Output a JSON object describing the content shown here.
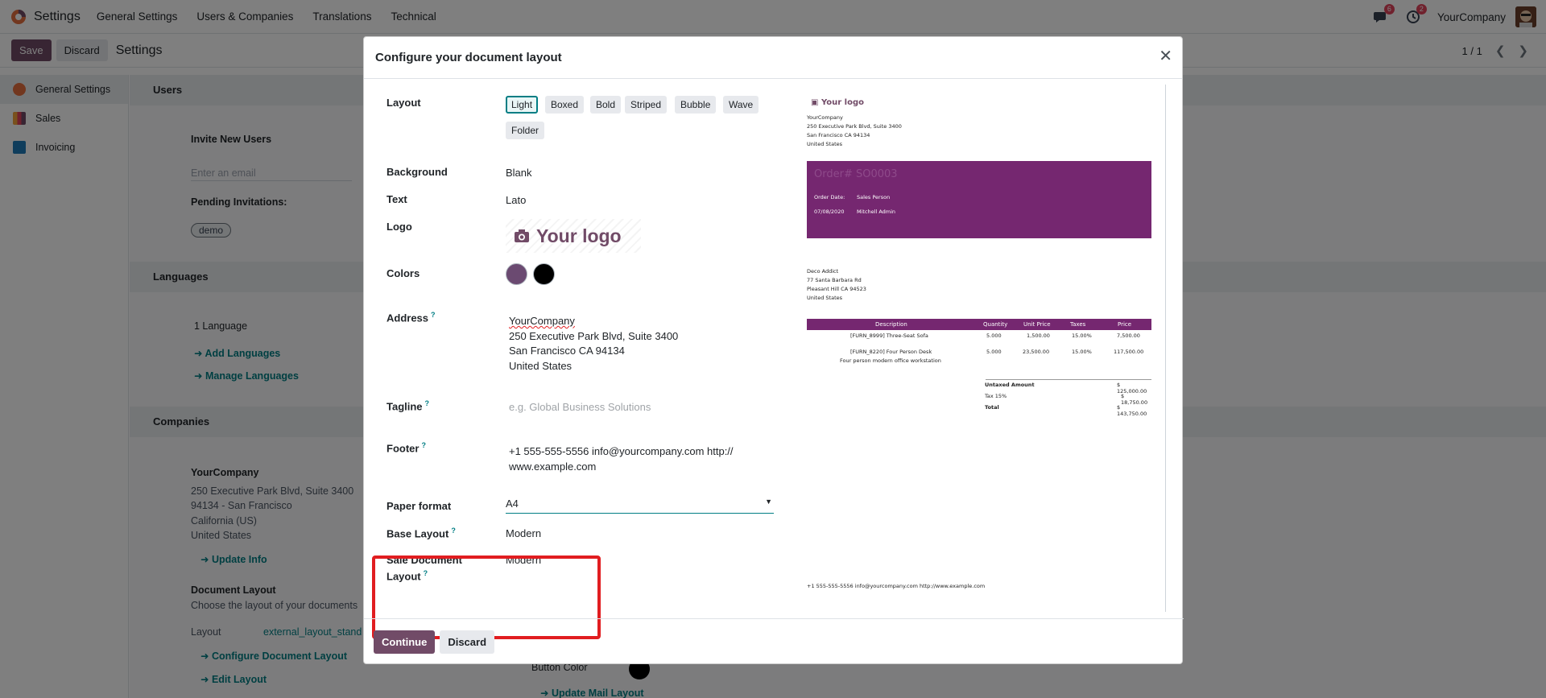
{
  "navbar": {
    "app_name": "Settings",
    "menus": [
      "General Settings",
      "Users & Companies",
      "Translations",
      "Technical"
    ],
    "messages_badge": "6",
    "activities_badge": "2",
    "company": "YourCompany"
  },
  "control": {
    "save_label": "Save",
    "discard_label": "Discard",
    "title": "Settings",
    "pager": "1 / 1"
  },
  "sidebar": {
    "items": [
      {
        "label": "General Settings",
        "icon": "settings-app-icon"
      },
      {
        "label": "Sales",
        "icon": "sales-app-icon"
      },
      {
        "label": "Invoicing",
        "icon": "invoicing-app-icon"
      }
    ]
  },
  "background": {
    "users_header": "Users",
    "invite_label": "Invite New Users",
    "invite_placeholder": "Enter an email",
    "pending_label": "Pending Invitations:",
    "pending_user": "demo",
    "languages_header": "Languages",
    "language_count": "1 Language",
    "add_languages": "Add Languages",
    "manage_languages": "Manage Languages",
    "companies_header": "Companies",
    "company_name": "YourCompany",
    "company_line1": "250 Executive Park Blvd, Suite 3400",
    "company_line2": "94134 - San Francisco",
    "company_line3": "California (US)",
    "company_line4": "United States",
    "update_info": "Update Info",
    "doc_layout_title": "Document Layout",
    "doc_layout_desc": "Choose the layout of your documents",
    "layout_label": "Layout",
    "layout_value": "external_layout_stand",
    "configure_doc_layout": "Configure Document Layout",
    "edit_layout": "Edit Layout",
    "button_color": "Button Color",
    "update_mail_layout": "Update Mail Layout"
  },
  "modal": {
    "title": "Configure your document layout",
    "fields": {
      "layout_label": "Layout",
      "layout_options": [
        "Light",
        "Boxed",
        "Bold",
        "Striped",
        "Bubble",
        "Wave",
        "Folder"
      ],
      "layout_selected": "Light",
      "background_label": "Background",
      "background_value": "Blank",
      "text_label": "Text",
      "text_value": "Lato",
      "logo_label": "Logo",
      "logo_text": "Your logo",
      "colors_label": "Colors",
      "primary_color": "#6b4a71",
      "secondary_color": "#000000",
      "address_label": "Address",
      "address_lines": [
        "YourCompany",
        "250 Executive Park Blvd, Suite 3400",
        "San Francisco CA 94134",
        "United States"
      ],
      "tagline_label": "Tagline",
      "tagline_placeholder": "e.g. Global Business Solutions",
      "footer_label": "Footer",
      "footer_line1": "+1 555-555-5556 info@yourcompany.com http://",
      "footer_line2": "www.example.com",
      "paper_label": "Paper format",
      "paper_value": "A4",
      "base_layout_label": "Base Layout",
      "base_layout_value": "Modern",
      "sale_layout_label_1": "Sale Document",
      "sale_layout_label_2": "Layout",
      "sale_layout_value": "Modern"
    },
    "preview": {
      "logo": "Your logo",
      "company_lines": [
        "YourCompany",
        "250 Executive Park Blvd, Suite 3400",
        "San Francisco CA 94134",
        "United States"
      ],
      "order_title": "Order# SO0003",
      "order_date_label": "Order Date:",
      "sales_person_label": "Sales Person",
      "order_date": "07/08/2020",
      "sales_person": "Mitchell Admin",
      "customer_lines": [
        "Deco Addict",
        "77 Santa Barbara Rd",
        "Pleasant Hill CA 94523",
        "United States"
      ],
      "table_headers": [
        "Description",
        "Quantity",
        "Unit Price",
        "Taxes",
        "Price"
      ],
      "rows": [
        {
          "desc": "[FURN_8999] Three-Seat Sofa",
          "desc2": "",
          "qty": "5.000",
          "unit": "1,500.00",
          "tax": "15.00%",
          "price": "7,500.00"
        },
        {
          "desc": "[FURN_8220] Four Person Desk",
          "desc2": "Four person modern office workstation",
          "qty": "5.000",
          "unit": "23,500.00",
          "tax": "15.00%",
          "price": "117,500.00"
        }
      ],
      "untaxed_label": "Untaxed Amount",
      "untaxed_value": "$ 125,000.00",
      "tax_label": "Tax 15%",
      "tax_value": "$ 18,750.00",
      "total_label": "Total",
      "total_value": "$ 143,750.00",
      "footer": "+1 555-555-5556 info@yourcompany.com http://www.example.com",
      "brand_color": "#752770"
    },
    "continue_label": "Continue",
    "discard_label": "Discard"
  }
}
